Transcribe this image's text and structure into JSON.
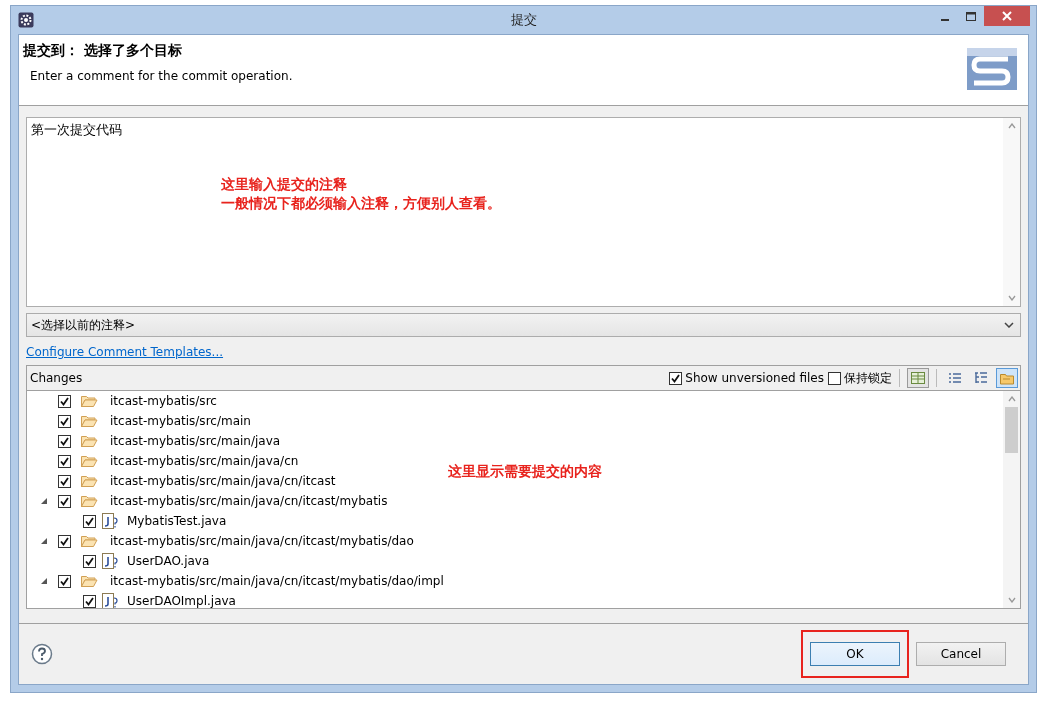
{
  "window": {
    "title": "提交"
  },
  "header": {
    "title": "提交到： 选择了多个目标",
    "subtitle": "Enter a comment for the commit operation."
  },
  "comment": {
    "value": "第一次提交代码"
  },
  "comment_annotation": [
    "这里输入提交的注释",
    "一般情况下都必须输入注释，方便别人查看。"
  ],
  "previous_comments": {
    "value": "<选择以前的注释>"
  },
  "configure_link": "Configure Comment Templates...",
  "changes": {
    "title": "Changes",
    "show_unversioned": {
      "label": "Show unversioned files",
      "checked": true
    },
    "keep_locks": {
      "label": "保持锁定",
      "checked": false
    },
    "toolbar": [
      {
        "kind": "grid",
        "selected": true
      },
      {
        "kind": "flat",
        "selected": false
      },
      {
        "kind": "tree",
        "selected": false
      },
      {
        "kind": "folder",
        "selected": true
      }
    ],
    "tree": [
      {
        "label": "itcast-mybatis/src",
        "kind": "folder",
        "checked": true
      },
      {
        "label": "itcast-mybatis/src/main",
        "kind": "folder",
        "checked": true
      },
      {
        "label": "itcast-mybatis/src/main/java",
        "kind": "folder",
        "checked": true
      },
      {
        "label": "itcast-mybatis/src/main/java/cn",
        "kind": "folder",
        "checked": true
      },
      {
        "label": "itcast-mybatis/src/main/java/cn/itcast",
        "kind": "folder",
        "checked": true
      },
      {
        "label": "itcast-mybatis/src/main/java/cn/itcast/mybatis",
        "kind": "folder",
        "checked": true,
        "expanded": true,
        "children": [
          {
            "label": "MybatisTest.java",
            "kind": "java",
            "checked": true
          }
        ]
      },
      {
        "label": "itcast-mybatis/src/main/java/cn/itcast/mybatis/dao",
        "kind": "folder",
        "checked": true,
        "expanded": true,
        "children": [
          {
            "label": "UserDAO.java",
            "kind": "java",
            "checked": true
          }
        ]
      },
      {
        "label": "itcast-mybatis/src/main/java/cn/itcast/mybatis/dao/impl",
        "kind": "folder",
        "checked": true,
        "expanded": true,
        "children": [
          {
            "label": "UserDAOImpl.java",
            "kind": "java",
            "checked": true
          }
        ]
      }
    ],
    "annotation": "这里显示需要提交的内容"
  },
  "buttons": [
    {
      "label": "OK",
      "kind": "default",
      "highlighted": true
    },
    {
      "label": "Cancel",
      "kind": "normal",
      "highlighted": false
    }
  ]
}
